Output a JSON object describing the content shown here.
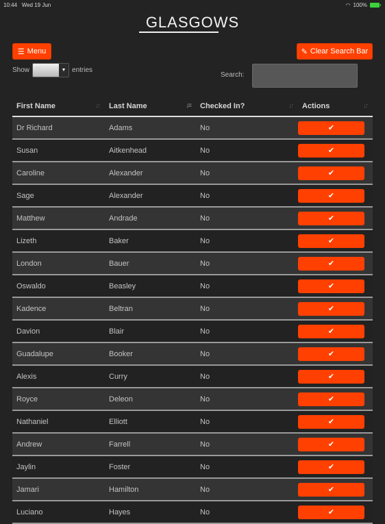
{
  "status_bar": {
    "time": "10:44",
    "date": "Wed 19 Jun",
    "battery": "100%",
    "wifi_icon": "wifi-icon",
    "battery_icon": "battery-charging-icon"
  },
  "header": {
    "logo": "GLASGOWS"
  },
  "toolbar": {
    "menu_label": "Menu",
    "menu_icon": "hamburger-icon",
    "clear_label": "Clear Search Bar",
    "clear_icon": "eraser-icon"
  },
  "length": {
    "show_label": "Show",
    "selected": "25",
    "entries_label": "entries"
  },
  "search": {
    "label": "Search:",
    "value": ""
  },
  "table": {
    "columns": [
      {
        "label": "First Name",
        "sort": "none"
      },
      {
        "label": "Last Name",
        "sort": "ascending"
      },
      {
        "label": "Checked In?",
        "sort": "none"
      },
      {
        "label": "Actions",
        "sort": "none"
      }
    ],
    "check_icon": "checkmark-icon",
    "rows": [
      {
        "first": "Dr Richard",
        "last": "Adams",
        "checked_in": "No"
      },
      {
        "first": "Susan",
        "last": "Aitkenhead",
        "checked_in": "No"
      },
      {
        "first": "Caroline",
        "last": "Alexander",
        "checked_in": "No"
      },
      {
        "first": "Sage",
        "last": "Alexander",
        "checked_in": "No"
      },
      {
        "first": "Matthew",
        "last": "Andrade",
        "checked_in": "No"
      },
      {
        "first": "Lizeth",
        "last": "Baker",
        "checked_in": "No"
      },
      {
        "first": "London",
        "last": "Bauer",
        "checked_in": "No"
      },
      {
        "first": "Oswaldo",
        "last": "Beasley",
        "checked_in": "No"
      },
      {
        "first": "Kadence",
        "last": "Beltran",
        "checked_in": "No"
      },
      {
        "first": "Davion",
        "last": "Blair",
        "checked_in": "No"
      },
      {
        "first": "Guadalupe",
        "last": "Booker",
        "checked_in": "No"
      },
      {
        "first": "Alexis",
        "last": "Curry",
        "checked_in": "No"
      },
      {
        "first": "Royce",
        "last": "Deleon",
        "checked_in": "No"
      },
      {
        "first": "Nathaniel",
        "last": "Elliott",
        "checked_in": "No"
      },
      {
        "first": "Andrew",
        "last": "Farrell",
        "checked_in": "No"
      },
      {
        "first": "Jaylin",
        "last": "Foster",
        "checked_in": "No"
      },
      {
        "first": "Jamari",
        "last": "Hamilton",
        "checked_in": "No"
      },
      {
        "first": "Luciano",
        "last": "Hayes",
        "checked_in": "No"
      }
    ]
  },
  "colors": {
    "accent": "#ff4000",
    "background": "#232323",
    "row_odd": "#343434",
    "row_even": "#222222"
  }
}
